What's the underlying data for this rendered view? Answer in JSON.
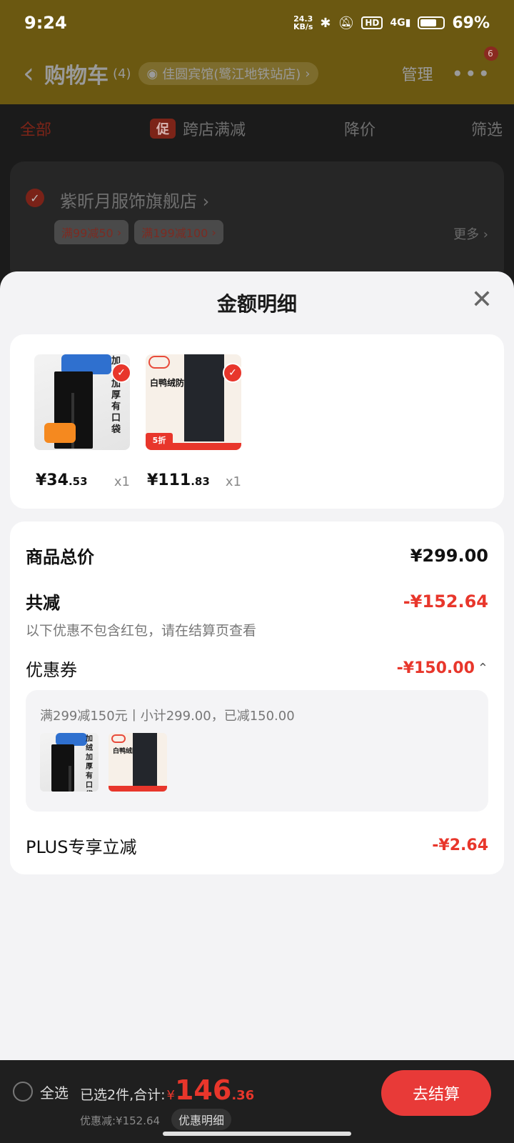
{
  "status_bar": {
    "time": "9:24",
    "net_speed": "24.3",
    "net_unit": "KB/s",
    "battery": "69%"
  },
  "header": {
    "back_icon": "chevron-left-icon",
    "title": "购物车",
    "count": "(4)",
    "location": "佳圆宾馆(鹭江地铁站店)",
    "manage": "管理",
    "more_badge": "6"
  },
  "tabs": {
    "all": "全部",
    "promo_badge": "促",
    "cross_store": "跨店满减",
    "price_drop": "降价",
    "filter": "筛选"
  },
  "store": {
    "name": "紫昕月服饰旗舰店",
    "chips": [
      "满99减50",
      "满199减100"
    ],
    "more": "更多"
  },
  "sheet": {
    "title": "金额明细",
    "products": [
      {
        "price_int": "¥34",
        "price_dec": ".53",
        "qty": "x1",
        "text": "加绒加厚 有口袋"
      },
      {
        "price_int": "¥111",
        "price_dec": ".83",
        "qty": "x1",
        "text": "白鸭绒防风裤",
        "tag": "5折"
      }
    ],
    "total_label": "商品总价",
    "total_value": "¥299.00",
    "reduce_label": "共减",
    "reduce_value": "-¥152.64",
    "reduce_note": "以下优惠不包含红包，请在结算页查看",
    "coupon_label": "优惠券",
    "coupon_value": "-¥150.00",
    "coupon_desc": "满299减150元丨小计299.00，已减150.00",
    "plus_label": "PLUS专享立减",
    "plus_value": "-¥2.64"
  },
  "checkout": {
    "select_all": "全选",
    "selected_text": "已选2件,合计:",
    "yen": "¥",
    "total_int": "146",
    "total_dec": ".36",
    "saved": "优惠减:¥152.64",
    "detail_button": "优惠明细",
    "pay_button": "去结算"
  }
}
